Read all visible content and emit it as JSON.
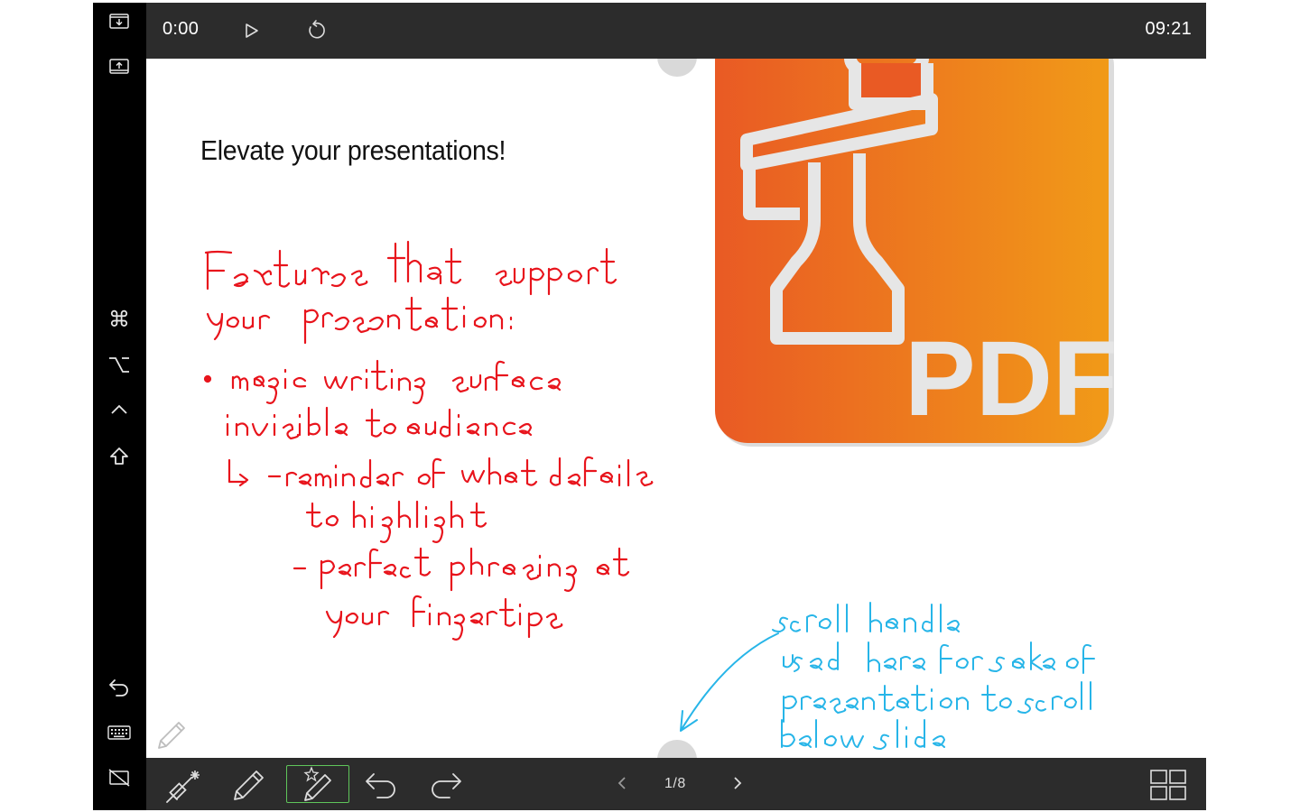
{
  "topbar": {
    "elapsed": "0:00",
    "clock": "09:21",
    "play_icon": "play-icon",
    "reset_icon": "reset-timer-icon"
  },
  "sidebar": {
    "items": [
      {
        "name": "download-icon"
      },
      {
        "name": "upload-icon"
      },
      {
        "name": "command-key-icon",
        "glyph": "⌘"
      },
      {
        "name": "option-key-icon",
        "glyph": "⌥"
      },
      {
        "name": "control-key-icon",
        "glyph": "^"
      },
      {
        "name": "shift-key-icon",
        "glyph": "⇧"
      },
      {
        "name": "undo-icon"
      },
      {
        "name": "keyboard-icon"
      },
      {
        "name": "hide-screen-icon"
      }
    ]
  },
  "slide": {
    "title": "Elevate your presentations!",
    "pdf_logo_text": "PDF",
    "handwriting_red": [
      "Features that support",
      "your presentation:",
      "• magic writing surface",
      "invisible to audience",
      "↳ - reminder of what details",
      "to highlight",
      "- perfect phrasing at",
      "your fingertips"
    ],
    "handwriting_blue": [
      "scroll handle",
      "used here for sake of",
      "presentation to scroll",
      "below slide"
    ],
    "colors": {
      "ink_red": "#e8141c",
      "ink_blue": "#27b5e8",
      "pdf_gradient_start": "#e95a24",
      "pdf_gradient_end": "#f19a18"
    }
  },
  "bottombar": {
    "tools": [
      {
        "name": "laser-pointer-tool-icon"
      },
      {
        "name": "pen-tool-icon"
      },
      {
        "name": "magic-pen-tool-icon",
        "active": true
      },
      {
        "name": "undo-icon"
      },
      {
        "name": "redo-icon"
      }
    ],
    "page_indicator": "1/8",
    "overview_icon": "grid-overview-icon"
  }
}
